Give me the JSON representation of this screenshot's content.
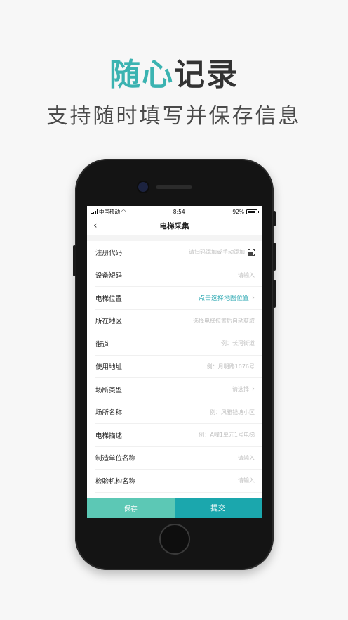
{
  "promo": {
    "title_accent": "随心",
    "title_rest": "记录",
    "subtitle": "支持随时填写并保存信息"
  },
  "colors": {
    "accent": "#3bb3b1",
    "save_button": "#5cc8b5",
    "submit_button": "#1ba7ad",
    "link": "#27a6b0"
  },
  "status_bar": {
    "carrier": "中国移动",
    "time": "8:54",
    "battery": "92%"
  },
  "nav": {
    "title": "电梯采集",
    "back_icon": "chevron-left-icon"
  },
  "form": {
    "rows": [
      {
        "label": "注册代码",
        "value": "请扫码添加或手动添加",
        "icon": "scan-icon"
      },
      {
        "label": "设备短码",
        "value": "请输入"
      },
      {
        "label": "电梯位置",
        "value": "点击选择地图位置",
        "icon": "chevron-right-icon"
      },
      {
        "label": "所在地区",
        "value": "选择电梯位置后自动获取"
      },
      {
        "label": "街道",
        "value": "例：长河街道"
      },
      {
        "label": "使用地址",
        "value": "例：月明路1076号"
      },
      {
        "label": "场所类型",
        "value": "请选择",
        "icon": "chevron-right-icon"
      },
      {
        "label": "场所名称",
        "value": "例：风雅钱塘小区"
      },
      {
        "label": "电梯描述",
        "value": "例：A幢1单元1号电梯"
      },
      {
        "label": "制造单位名称",
        "value": "请输入"
      },
      {
        "label": "检验机构名称",
        "value": "请输入"
      }
    ]
  },
  "actions": {
    "save_label": "保存",
    "submit_label": "提交"
  }
}
